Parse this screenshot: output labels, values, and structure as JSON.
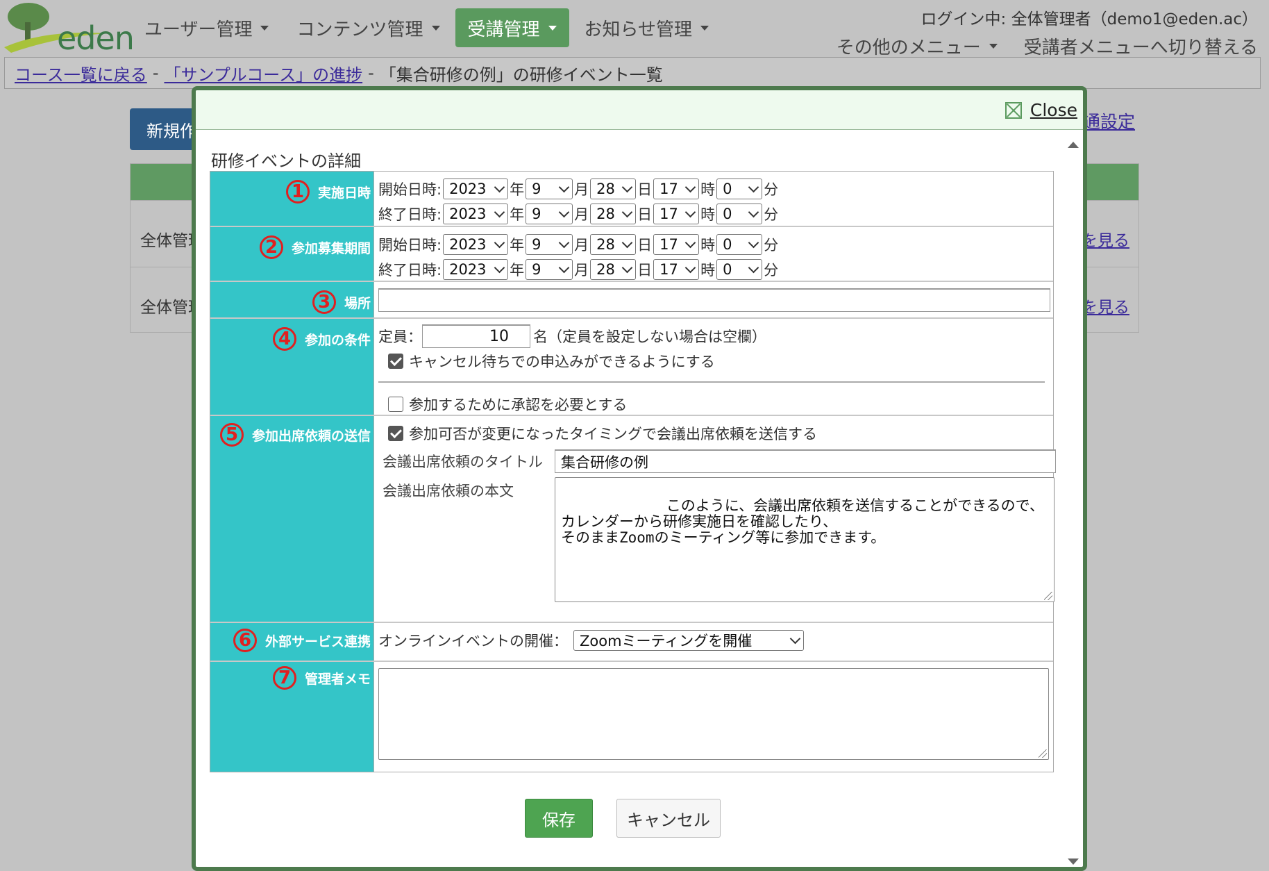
{
  "logo": {
    "text": "eden"
  },
  "nav": [
    {
      "label": "ユーザー管理",
      "active": false
    },
    {
      "label": "コンテンツ管理",
      "active": false
    },
    {
      "label": "受講管理",
      "active": true
    },
    {
      "label": "お知らせ管理",
      "active": false
    }
  ],
  "login_info": "ログイン中: 全体管理者（demo1@eden.ac）",
  "sub_menu": {
    "other": "その他のメニュー",
    "switch": "受講者メニューへ切り替える"
  },
  "breadcrumb": {
    "back": "コース一覧に戻る",
    "sep1": "-",
    "progress": "「サンプルコース」の進捗",
    "sep2": "-",
    "current": "「集合研修の例」の研修イベント一覧"
  },
  "background": {
    "new_button": "新規作",
    "setting_link": "通設定",
    "rows": [
      {
        "cell": "全体管理",
        "link": "を見る"
      },
      {
        "cell": "全体管理",
        "link": "を見る"
      }
    ]
  },
  "modal": {
    "close_label": "Close",
    "title": "研修イベントの詳細",
    "datetime_units": {
      "year": "年",
      "month": "月",
      "day": "日",
      "hour": "時",
      "minute": "分"
    },
    "sections": {
      "s1": {
        "num": "1",
        "label": "実施日時",
        "start_label": "開始日時:",
        "end_label": "終了日時:",
        "start": {
          "year": "2023",
          "month": "9",
          "day": "28",
          "hour": "17",
          "minute": "0"
        },
        "end": {
          "year": "2023",
          "month": "9",
          "day": "28",
          "hour": "17",
          "minute": "0"
        }
      },
      "s2": {
        "num": "2",
        "label": "参加募集期間",
        "start_label": "開始日時:",
        "end_label": "終了日時:",
        "start": {
          "year": "2023",
          "month": "9",
          "day": "28",
          "hour": "17",
          "minute": "0"
        },
        "end": {
          "year": "2023",
          "month": "9",
          "day": "28",
          "hour": "17",
          "minute": "0"
        }
      },
      "s3": {
        "num": "3",
        "label": "場所",
        "value": ""
      },
      "s4": {
        "num": "4",
        "label": "参加の条件",
        "capacity_label": "定員：",
        "capacity_value": "10",
        "capacity_note": "名（定員を設定しない場合は空欄）",
        "waitlist_label": "キャンセル待ちでの申込みができるようにする",
        "waitlist_checked": true,
        "approval_label": "参加するために承認を必要とする",
        "approval_checked": false
      },
      "s5": {
        "num": "5",
        "label": "参加出席依頼の送信",
        "send_label": "参加可否が変更になったタイミングで会議出席依頼を送信する",
        "send_checked": true,
        "title_label": "会議出席依頼のタイトル",
        "title_value": "集合研修の例",
        "body_label": "会議出席依頼の本文",
        "body_value": "このように、会議出席依頼を送信することができるので、\nカレンダーから研修実施日を確認したり、\nそのままZoomのミーティング等に参加できます。"
      },
      "s6": {
        "num": "6",
        "label": "外部サービス連携",
        "online_label": "オンラインイベントの開催：",
        "online_value": "Zoomミーティングを開催"
      },
      "s7": {
        "num": "7",
        "label": "管理者メモ",
        "value": ""
      }
    },
    "save_label": "保存",
    "cancel_label": "キャンセル"
  }
}
